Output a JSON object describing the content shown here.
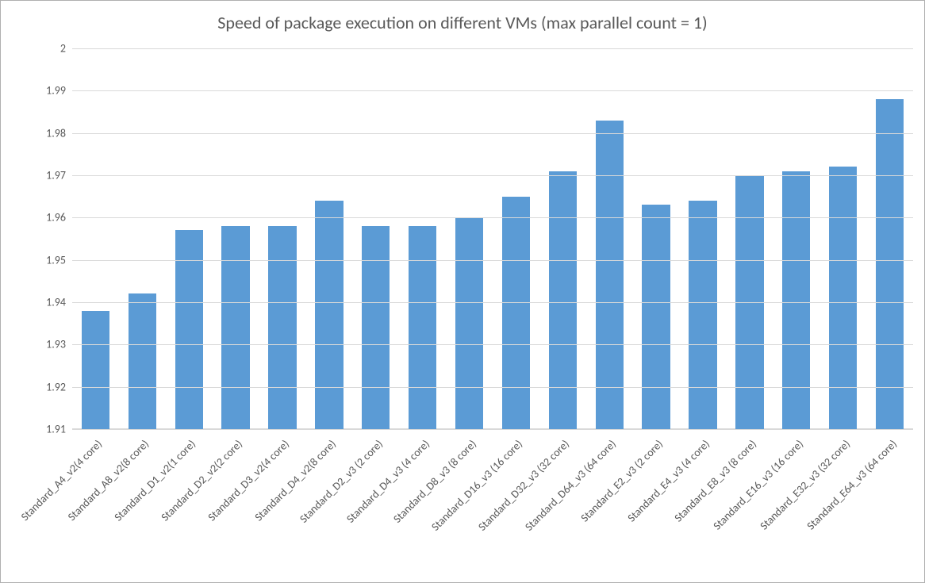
{
  "chart_data": {
    "type": "bar",
    "title": "Speed of package execution on different VMs (max parallel count = 1)",
    "xlabel": "",
    "ylabel": "",
    "ylim": [
      1.91,
      2.0
    ],
    "yticks": [
      1.91,
      1.92,
      1.93,
      1.94,
      1.95,
      1.96,
      1.97,
      1.98,
      1.99,
      2.0
    ],
    "ytick_labels": [
      "1.91",
      "1.92",
      "1.93",
      "1.94",
      "1.95",
      "1.96",
      "1.97",
      "1.98",
      "1.99",
      "2"
    ],
    "categories": [
      "Standard_A4_v2(4 core)",
      "Standard_A8_v2(8 core)",
      "Standard_D1_v2(1 core)",
      "Standard_D2_v2(2 core)",
      "Standard_D3_v2(4 core)",
      "Standard_D4_v2(8 core)",
      "Standard_D2_v3 (2 core)",
      "Standard_D4_v3 (4 core)",
      "Standard_D8_v3 (8 core)",
      "Standard_D16_v3 (16 core)",
      "Standard_D32_v3 (32 core)",
      "Standard_D64_v3 (64 core)",
      "Standard_E2_v3 (2 core)",
      "Standard_E4_v3 (4 core)",
      "Standard_E8_v3 (8 core)",
      "Standard_E16_v3 (16 core)",
      "Standard_E32_v3 (32 core)",
      "Standard_E64_v3 (64 core)"
    ],
    "values": [
      1.938,
      1.942,
      1.957,
      1.958,
      1.958,
      1.964,
      1.958,
      1.958,
      1.96,
      1.965,
      1.971,
      1.983,
      1.963,
      1.964,
      1.97,
      1.971,
      1.972,
      1.988
    ],
    "bar_color": "#5b9bd5",
    "grid_color": "#d9d9d9"
  }
}
